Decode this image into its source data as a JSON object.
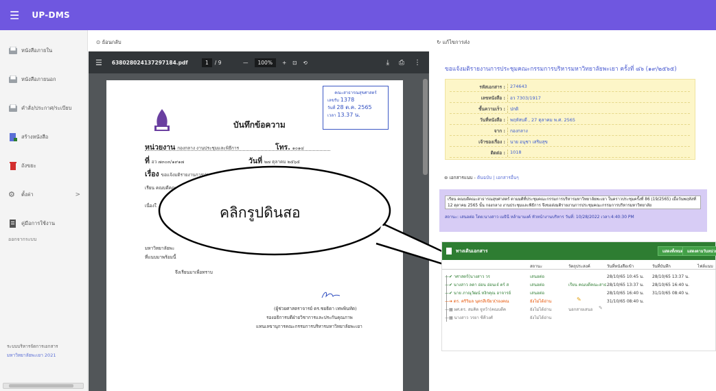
{
  "app": {
    "title": "UP-DMS",
    "menu_icon": "hamburger-icon",
    "accent": "#6f57e0"
  },
  "sidebar": {
    "items": [
      {
        "label": "หนังสือภายใน",
        "icon": "inbox-icon"
      },
      {
        "label": "หนังสือภายนอก",
        "icon": "inbox-icon"
      },
      {
        "label": "คำสั่ง/ประกาศ/ระเบียบ",
        "icon": "inbox-icon"
      },
      {
        "label": "สร้างหนังสือ",
        "icon": "create-doc-icon"
      },
      {
        "label": "ถังขยะ",
        "icon": "trash-icon"
      },
      {
        "label": "ตั้งค่า",
        "icon": "gear-icon",
        "chevron": ">"
      },
      {
        "label": "คู่มือการใช้งาน",
        "icon": "manual-icon"
      }
    ],
    "logout": "ออกจากระบบ",
    "footer_line1": "ระบบบริหารจัดการเอกสาร",
    "footer_line2": "มหาวิทยาลัยพะเยา 2021"
  },
  "left_panel": {
    "back_label": "ย้อนกลับ",
    "back_icon": "back-arrow-icon"
  },
  "pdf_viewer": {
    "filename": "638028024137297184.pdf",
    "page_current": "1",
    "page_total": "/ 9",
    "zoom_minus": "—",
    "zoom": "100%",
    "zoom_plus": "+",
    "fit_icon": "fit-page-icon",
    "rotate_icon": "rotate-icon",
    "download_icon": "download-icon",
    "print_icon": "print-icon",
    "more_icon": "more-vertical-icon"
  },
  "document": {
    "stamp_line1": "คณะสาธารณสุขศาสตร์",
    "stamp_line2_label": "เลขรับ",
    "stamp_line2_value": "1378",
    "stamp_line3_label": "วันที่",
    "stamp_line3_value": "28 ต.ค. 2565",
    "stamp_line4_label": "เวลา",
    "stamp_line4_value": "13.37 น.",
    "title": "บันทึกข้อความ",
    "dept_label": "หน่วยงาน",
    "dept_value": "กองกลาง งานประชุมและพิธีการ",
    "tel_label": "โทร.",
    "tel_value": "๑๐๑๔",
    "no_label": "ที่",
    "no_value": "อว ๗๓๐๓/๑๙๑๗",
    "date_label": "วันที่",
    "date_value": "๒๗ ตุลาคม ๒๕๖๕",
    "subject_label": "เรื่อง",
    "subject_value": "ขอแจ้งมติรายงานการประ",
    "subject_tail": "(๑๙/๒๕๖๕)",
    "to_line": "เรียน  คณบดีคณ",
    "body1": "เนื่องใ",
    "body2": "มหาวิทยาลัยพะ",
    "body3": "ที่แนบมาพร้อมนี้",
    "closing": "จึงเรียนมาเพื่อทราบ",
    "signer1": "(ผู้ช่วยศาสตราจารย์ ดร.ชยธิดา  เทพพินทัด)",
    "signer2": "รองอธิการบดีฝ่ายวิชาการและประกันคุณภาพ",
    "signer3": "แทนเลขานุการคณะกรรมการบริหารมหาวิทยาลัยพะเยา"
  },
  "callout": {
    "text": "คลิกรูปดินสอ"
  },
  "right_panel": {
    "edit_label": "แก้ไขการส่ง",
    "edit_icon": "refresh-icon",
    "title": "ขอแจ้งมติรายงานการประชุมคณะกรรมการบริหารมหาวิทยาลัยพะเยา ครั้งที่ ๘๖ (๑๙/๒๕๖๕)",
    "info": [
      {
        "key": "รหัสเอกสาร :",
        "value": "274643"
      },
      {
        "key": "เลขหนังสือ :",
        "value": "อว 7303/1917"
      },
      {
        "key": "ชั้นความเร็ว :",
        "value": "ปกติ"
      },
      {
        "key": "วันที่หนังสือ :",
        "value": "พฤหัสบดี , 27 ตุลาคม พ.ศ. 2565"
      },
      {
        "key": "จาก :",
        "value": "กองกลาง"
      },
      {
        "key": "เจ้าของเรื่อง :",
        "value": "นาย อนุชา เสริมสุข"
      },
      {
        "key": "ติดต่อ :",
        "value": "1018"
      }
    ],
    "attach_label": "เอกสารแนบ -",
    "attach_link1": "ต้นฉบับ",
    "attach_sep": "|",
    "attach_link2": "เอกสารอื่นๆ",
    "attach_icon": "paperclip-icon",
    "note": "เรียน คณบดีคณะสาธารณสุขศาสตร์ ตามมติที่ประชุมคณะกรรมการบริหารมหาวิทยาลัยพะเยา ในคราวประชุมครั้งที่ 86 (19/2565) เมื่อวันพฤหัสที่ 12 ตุลาคม 2565 นั้น กองกลาง งานประชุมและพิธีการ จึงขอส่งมติรายงานการประชุมคณะกรรมการบริหารมหาวิทยาลัย",
    "status_line": "สถานะ: เสนอต่อ  โดย:นางสาว เมธินี หล้ามามงค์ หัวหน้างานบริหาร  วันที่: 10/28/2022  เวลา:4:40:30 PM",
    "route": {
      "title": "ทางเดินเอกสาร",
      "btn1": "แสดงทั้งหมด",
      "btn2": "แสดงตามวันหน่วย",
      "columns": [
        "สถานะ",
        "วัตถุประสงค์",
        "วันที่หนังสือเข้า",
        "วันที่บันทึก",
        "ไฟล์แนบ"
      ],
      "rows": [
        {
          "who": "—✔ าศาสตร์(นางสาว วร",
          "status": "เสนอต่อ",
          "purpose": "",
          "in": "28/10/65 10:45 น.",
          "rec": "28/10/65 13:37 น."
        },
        {
          "who": "—✔ นางสาว ลดา อ่อน อ่อนเจ๋ ตร์ ส",
          "status": "เสนอต่อ",
          "purpose": "เรียน คณบดีคณะสาธ",
          "in": "28/10/65 13:37 น.",
          "rec": "28/10/65 16:40 น."
        },
        {
          "who": "—✔ นาย ภาณุวัฒน์ หงิกคุณ อาจารย์",
          "status": "เสนอต่อ",
          "purpose": "",
          "in": "28/10/65 16:40 น.",
          "rec": "31/10/65 08:40 น."
        },
        {
          "who": "—➔ ดร. คริวิมล นุตรสีเขียว(รองคณ",
          "status": "ยังไม่ได้อ่าน",
          "purpose": "",
          "in": "31/10/65 08:40 น.",
          "rec": ""
        },
        {
          "who": "—▦ ผศ.ดร. สมคิด จูหว้า(คณบดีค",
          "status": "ยังไม่ได้อ่าน",
          "purpose": "นอกสายเสนอ",
          "in": "",
          "rec": ""
        },
        {
          "who": "—▦ นางสาว วรยา ซีคีวงศ์",
          "status": "ยังไม่ได้อ่าน",
          "purpose": "",
          "in": "",
          "rec": ""
        }
      ]
    }
  }
}
